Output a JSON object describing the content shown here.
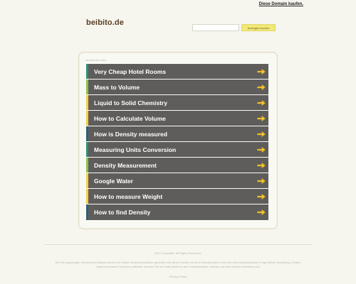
{
  "header": {
    "buy_domain": "Diese Domain kaufen.",
    "site_title": "beibito.de"
  },
  "search": {
    "placeholder": "",
    "button_label": "Anzeigen suchen"
  },
  "panel": {
    "label": "Verwandte Links",
    "links": [
      {
        "label": "Very Cheap Hotel Rooms",
        "accent": "#2f8f73"
      },
      {
        "label": "Mass to Volume",
        "accent": "#8bc34a"
      },
      {
        "label": "Liquid to Solid Chemistry",
        "accent": "#f2d046"
      },
      {
        "label": "How to Calculate Volume",
        "accent": "#f2d046"
      },
      {
        "label": "How is Density measured",
        "accent": "#2f5f77"
      },
      {
        "label": "Measuring Units Conversion",
        "accent": "#2f8f73"
      },
      {
        "label": "Density Measurement",
        "accent": "#8bc34a"
      },
      {
        "label": "Google Water",
        "accent": "#f2d046"
      },
      {
        "label": "How to measure Weight",
        "accent": "#f2d046"
      },
      {
        "label": "How to find Density",
        "accent": "#2f5f77"
      }
    ]
  },
  "footer": {
    "copyright": "2019 Copyright. All Rights Reserved.",
    "disclaimer": "Die Sie angezeigten Sponsored Listings werden von dritten Seite automatisch generiert und stehen weder mit dem Domaininhaber noch mit dem Domaininhaber in irgendeiner Beziehung. Sollten markenrechtliche Probleme auftreten, wenden Sie sich bitte direkt an den Domaininhaber, welcher aus dem Whois ersichtlich wird.",
    "privacy": "Privacy Policy"
  },
  "colors": {
    "background": "#f6f5ee",
    "row_background": "#5e5d5b",
    "arrow": "#f1c232",
    "title": "#5a3f26"
  }
}
